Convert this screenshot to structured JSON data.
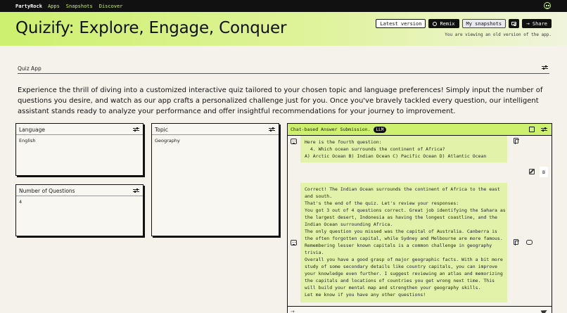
{
  "nav": {
    "brand": "PartyRock",
    "links": [
      "Apps",
      "Snapshots",
      "Discover"
    ]
  },
  "header": {
    "title": "Quizify: Explore, Engage, Conquer",
    "buttons": {
      "latest_version": "Latest version",
      "remix": "Remix",
      "my_snapshots": "My snapshots",
      "share": "Share"
    },
    "old_version_note": "You are viewing an old version of the app."
  },
  "section": {
    "label": "Quiz App",
    "description": "Experience the thrill of diving into a customized interactive quiz tailored to your chosen topic and language preferences! Simply input the number of questions you desire, and watch as our app crafts a personalized challenge just for you. Once you've bravely tackled every question, our intelligent assistant stands ready to analyze your performance and offer insightful recommendations for your journey to improvement."
  },
  "widgets": {
    "language": {
      "title": "Language",
      "value": "English"
    },
    "topic": {
      "title": "Topic",
      "value": "Geography"
    },
    "num_questions": {
      "title": "Number of Questions",
      "value": "4"
    }
  },
  "chat": {
    "title": "Chat-based Answer Submission.",
    "badge": "LLM",
    "messages": [
      {
        "role": "assistant",
        "text": "Here is the fourth question:\n  4. Which ocean surrounds the continent of Africa?\nA) Arctic Ocean B) Indian Ocean C) Pacific Ocean D) Atlantic Ocean"
      },
      {
        "role": "user",
        "text": "B"
      },
      {
        "role": "assistant",
        "text": "Correct! The Indian Ocean surrounds the continent of Africa to the east\nand south.\nThat's the end of the quiz. Let's review your responses:\nYou got 3 out of 4 questions correct. Great job identifying the Sahara as\nthe largest desert, Indonesia as having the longest coastline, and the\nIndian Ocean surrounding Africa.\nThe only question you missed was the capital of Australia. Canberra is\nthe often forgotten capital, while Sydney and Melbourne are more famous.\nRemembering lesser known capitals is a common challenge in geography\ntrivia.\nOverall you have a good grasp of major geographic facts. With a bit more\nstudy of some secondary details like country capitals, you can improve\nyour knowledge even further. I suggest reviewing an atlas and memorizing\nthe capitals and locations of countries you get wrong next time. This\nwill build your mental map and strengthen your geography skills.\nLet me know if you have any other questions!"
      }
    ]
  },
  "colors": {
    "accent": "#cdf06e",
    "bubble": "#e2f3a9",
    "nav_bg": "#111111",
    "page_bg": "#f4f2ea"
  }
}
